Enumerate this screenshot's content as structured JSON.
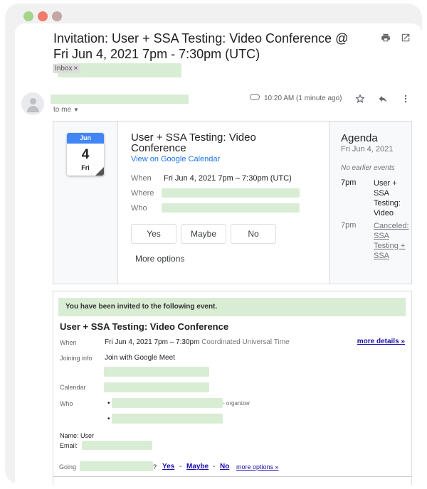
{
  "window": {
    "dots": [
      {
        "name": "dot-green",
        "color": "#a6d48b"
      },
      {
        "name": "dot-red",
        "color": "#f07a6b"
      },
      {
        "name": "dot-gray",
        "color": "#c4a7a3"
      }
    ]
  },
  "header": {
    "subject": "Invitation: User + SSA Testing: Video Conference @ Fri Jun 4, 2021 7pm - 7:30pm (UTC)",
    "label_tag": "Inbox",
    "label_tag_remove": "×",
    "print_icon": "print-icon",
    "open_new_window_icon": "open-in-new-icon"
  },
  "message": {
    "to": "to me",
    "time": "10:20 AM (1 minute ago)",
    "icons": [
      "attachment-icon",
      "star-icon",
      "reply-icon",
      "more-vert-icon"
    ]
  },
  "event_card": {
    "cal_month": "Jun",
    "cal_day": "4",
    "cal_weekday": "Fri",
    "title": "User + SSA Testing: Video Conference",
    "view_link": "View on Google Calendar",
    "when_label": "When",
    "when_value": "Fri Jun 4, 2021 7pm – 7:30pm (UTC)",
    "where_label": "Where",
    "who_label": "Who",
    "rsvp": {
      "yes": "Yes",
      "maybe": "Maybe",
      "no": "No"
    },
    "more_options": "More options"
  },
  "agenda": {
    "title": "Agenda",
    "date": "Fri Jun 4, 2021",
    "no_earlier": "No earlier events",
    "items": [
      {
        "time": "7pm",
        "text": "User + SSA Testing: Video Conference"
      },
      {
        "time": "7pm",
        "text": "Canceled: SSA Testing + SSA Testing: ..."
      }
    ]
  },
  "invite": {
    "banner": "You have been invited to the following event.",
    "title": "User + SSA Testing: Video Conference",
    "when_label": "When",
    "when_value": "Fri Jun 4, 2021 7pm – 7:30pm",
    "when_tz": "Coordinated Universal Time",
    "more_details": "more details »",
    "joining_label": "Joining info",
    "joining_value": "Join with Google Meet",
    "calendar_label": "Calendar",
    "who_label": "Who",
    "organizer": "- organizer",
    "name_line": "Name: User",
    "email_label": "Email:",
    "going_label": "Going",
    "going_q": "?",
    "going_yes": "Yes",
    "going_maybe": "Maybe",
    "going_no": "No",
    "going_sep": "-",
    "more_options": "more options »"
  },
  "colors": {
    "redaction": "#d9edd5",
    "link": "#1a73e8",
    "frame": "#f1f1f1"
  }
}
